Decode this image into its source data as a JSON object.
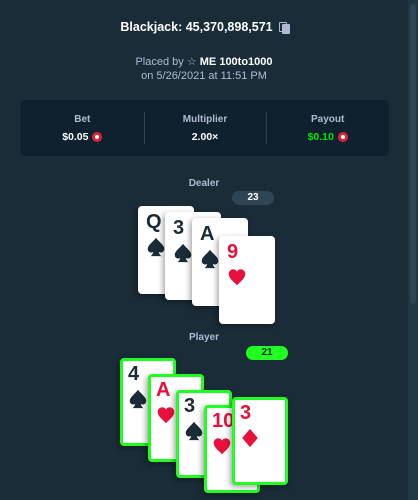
{
  "bet": {
    "title": "Blackjack: 45,370,898,571",
    "placed_by_prefix": "Placed by",
    "user": "ME 100to1000",
    "placed_on": "on 5/26/2021 at 11:51 PM"
  },
  "stats": {
    "bet_label": "Bet",
    "bet_value": "$0.05",
    "multiplier_label": "Multiplier",
    "multiplier_value": "2.00×",
    "payout_label": "Payout",
    "payout_value": "$0.10"
  },
  "colors": {
    "background": "#1a2c38",
    "panel": "#0f212e",
    "win_green": "#1fff20",
    "payout_green": "#00e701",
    "card_red": "#e9113c"
  },
  "dealer": {
    "label": "Dealer",
    "score": "23",
    "cards": [
      {
        "rank": "Q",
        "suit": "spade",
        "color": "black"
      },
      {
        "rank": "3",
        "suit": "spade",
        "color": "black"
      },
      {
        "rank": "A",
        "suit": "spade",
        "color": "black"
      },
      {
        "rank": "9",
        "suit": "heart",
        "color": "red"
      }
    ]
  },
  "player": {
    "label": "Player",
    "score": "21",
    "cards": [
      {
        "rank": "4",
        "suit": "spade",
        "color": "black"
      },
      {
        "rank": "A",
        "suit": "heart",
        "color": "red"
      },
      {
        "rank": "3",
        "suit": "spade",
        "color": "black"
      },
      {
        "rank": "10",
        "suit": "heart",
        "color": "red"
      },
      {
        "rank": "3",
        "suit": "diamond",
        "color": "red"
      }
    ]
  }
}
